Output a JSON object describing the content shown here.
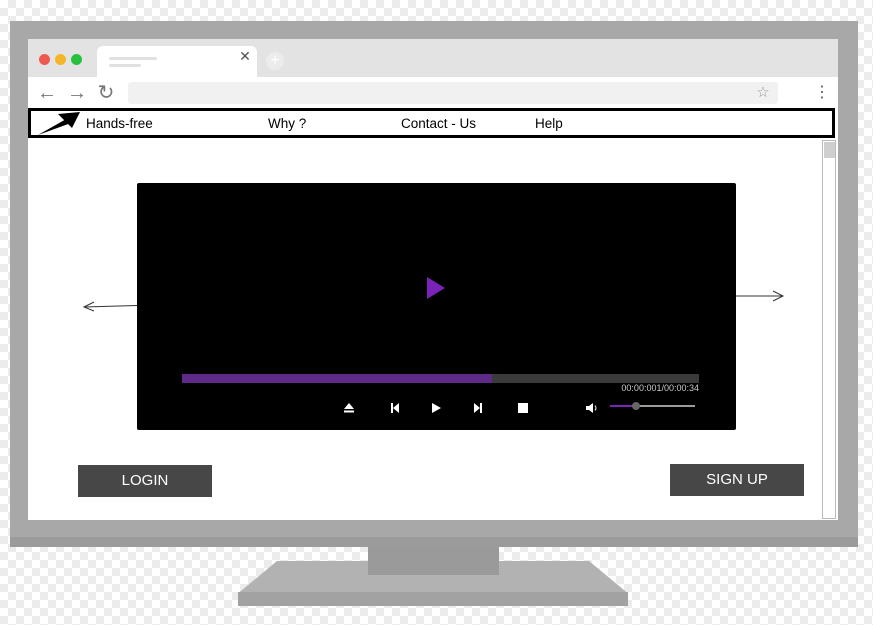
{
  "nav": {
    "brand": "Hands-free",
    "links": [
      "Why ?",
      "Contact - Us",
      "Help"
    ]
  },
  "video": {
    "progress": 0.6,
    "timecode": "00:00:001/00:00:34",
    "volume": 0.3,
    "accent_color": "#7b22b8",
    "controls": [
      "eject-icon",
      "previous-icon",
      "play-icon",
      "next-icon",
      "stop-icon",
      "volume-icon"
    ]
  },
  "buttons": {
    "login": "LOGIN",
    "signup": "SIGN UP"
  },
  "colors": {
    "button_bg": "#474747",
    "monitor_frame": "#a8a8a8",
    "video_bg": "#000000"
  }
}
